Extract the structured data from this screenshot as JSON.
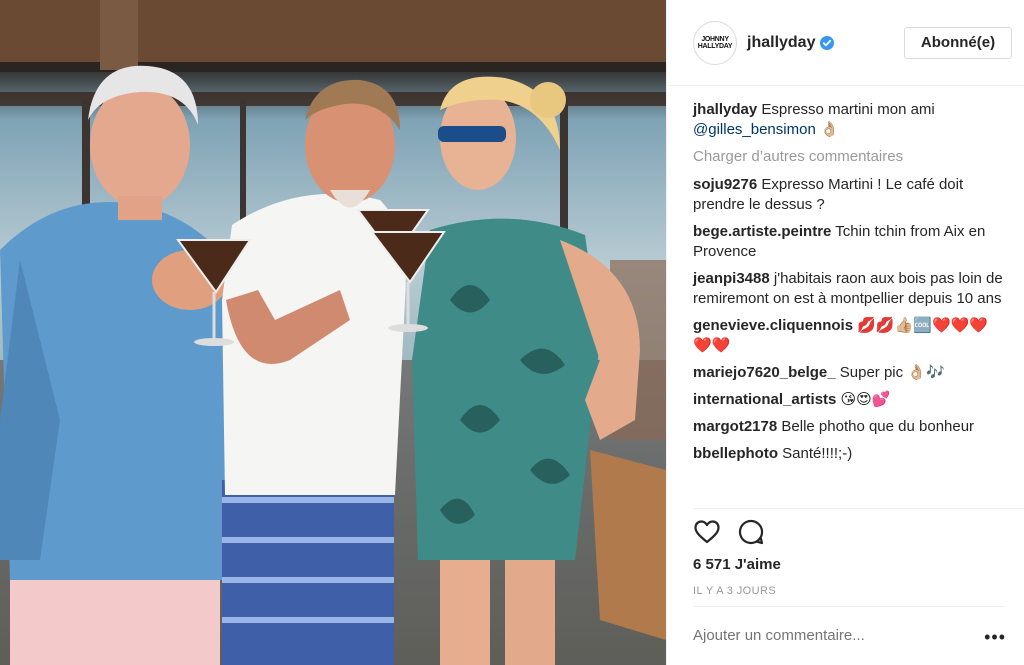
{
  "post": {
    "photo_alt": "Photo"
  },
  "header": {
    "avatar_line1": "JOHNNY",
    "avatar_line2": "HALLYDAY",
    "username": "jhallyday",
    "verified_icon": "verified-badge-icon",
    "follow_label": "Abonné(e)"
  },
  "caption": {
    "user": "jhallyday",
    "text": "Espresso martini mon ami",
    "mention": "@gilles_bensimon",
    "emoji": "👌🏼"
  },
  "load_more": "Charger d’autres commentaires",
  "comments": [
    {
      "user": "soju9276",
      "text": "Expresso Martini ! Le café doit prendre le dessus ?"
    },
    {
      "user": "bege.artiste.peintre",
      "text": "Tchin tchin from Aix en Provence"
    },
    {
      "user": "jeanpi3488",
      "text": "j'habitais raon aux bois pas loin de remiremont on est à montpellier depuis 10 ans"
    },
    {
      "user": "genevieve.cliquennois",
      "text": "💋💋👍🏼🆒❤️❤️❤️❤️❤️"
    },
    {
      "user": "mariejo7620_belge_",
      "text": "Super pic 👌🏼🎶"
    },
    {
      "user": "international_artists",
      "text": "😘😍💕"
    },
    {
      "user": "margot2178",
      "text": "Belle photho que du bonheur"
    },
    {
      "user": "bbellephoto",
      "text": "Santé!!!!;-)"
    }
  ],
  "actions": {
    "like_icon": "heart-icon",
    "comment_icon": "comment-bubble-icon"
  },
  "likes": "6 571 J'aime",
  "time_ago": "IL Y A 3 JOURS",
  "add_comment_placeholder": "Ajouter un commentaire...",
  "more_label": "•••",
  "colors": {
    "accent_blue": "#3897f0",
    "mention": "#003569",
    "muted": "#999999",
    "border": "#efefef"
  }
}
